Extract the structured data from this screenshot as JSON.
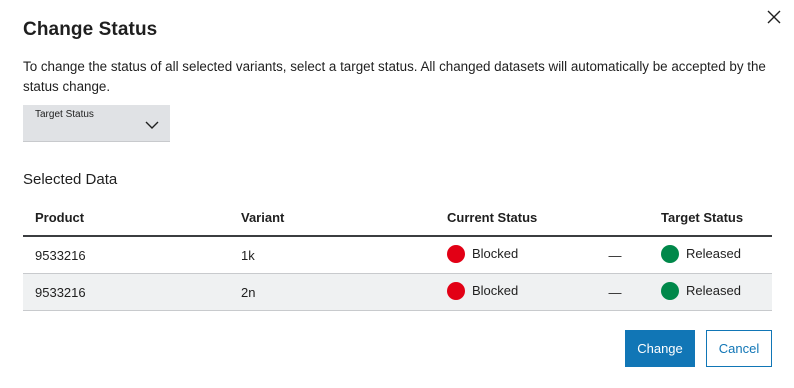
{
  "dialog": {
    "title": "Change Status",
    "description": "To change the status of all selected variants, select a target status. All changed datasets will automatically be accepted by the status change.",
    "close_icon": "close-icon"
  },
  "target_select": {
    "label": "Target Status",
    "value": "",
    "icon": "chevron-down-icon"
  },
  "section_title": "Selected Data",
  "table": {
    "headers": {
      "product": "Product",
      "variant": "Variant",
      "current_status": "Current Status",
      "arrow": "",
      "target_status": "Target Status"
    },
    "rows": [
      {
        "product": "9533216",
        "variant": "1k",
        "current_status": "Blocked",
        "arrow": "—",
        "target_status": "Released"
      },
      {
        "product": "9533216",
        "variant": "2n",
        "current_status": "Blocked",
        "arrow": "—",
        "target_status": "Released"
      }
    ]
  },
  "colors": {
    "blocked": "#e20015",
    "released": "#00884a",
    "primary": "#1176b6"
  },
  "actions": {
    "change_label": "Change",
    "cancel_label": "Cancel"
  }
}
